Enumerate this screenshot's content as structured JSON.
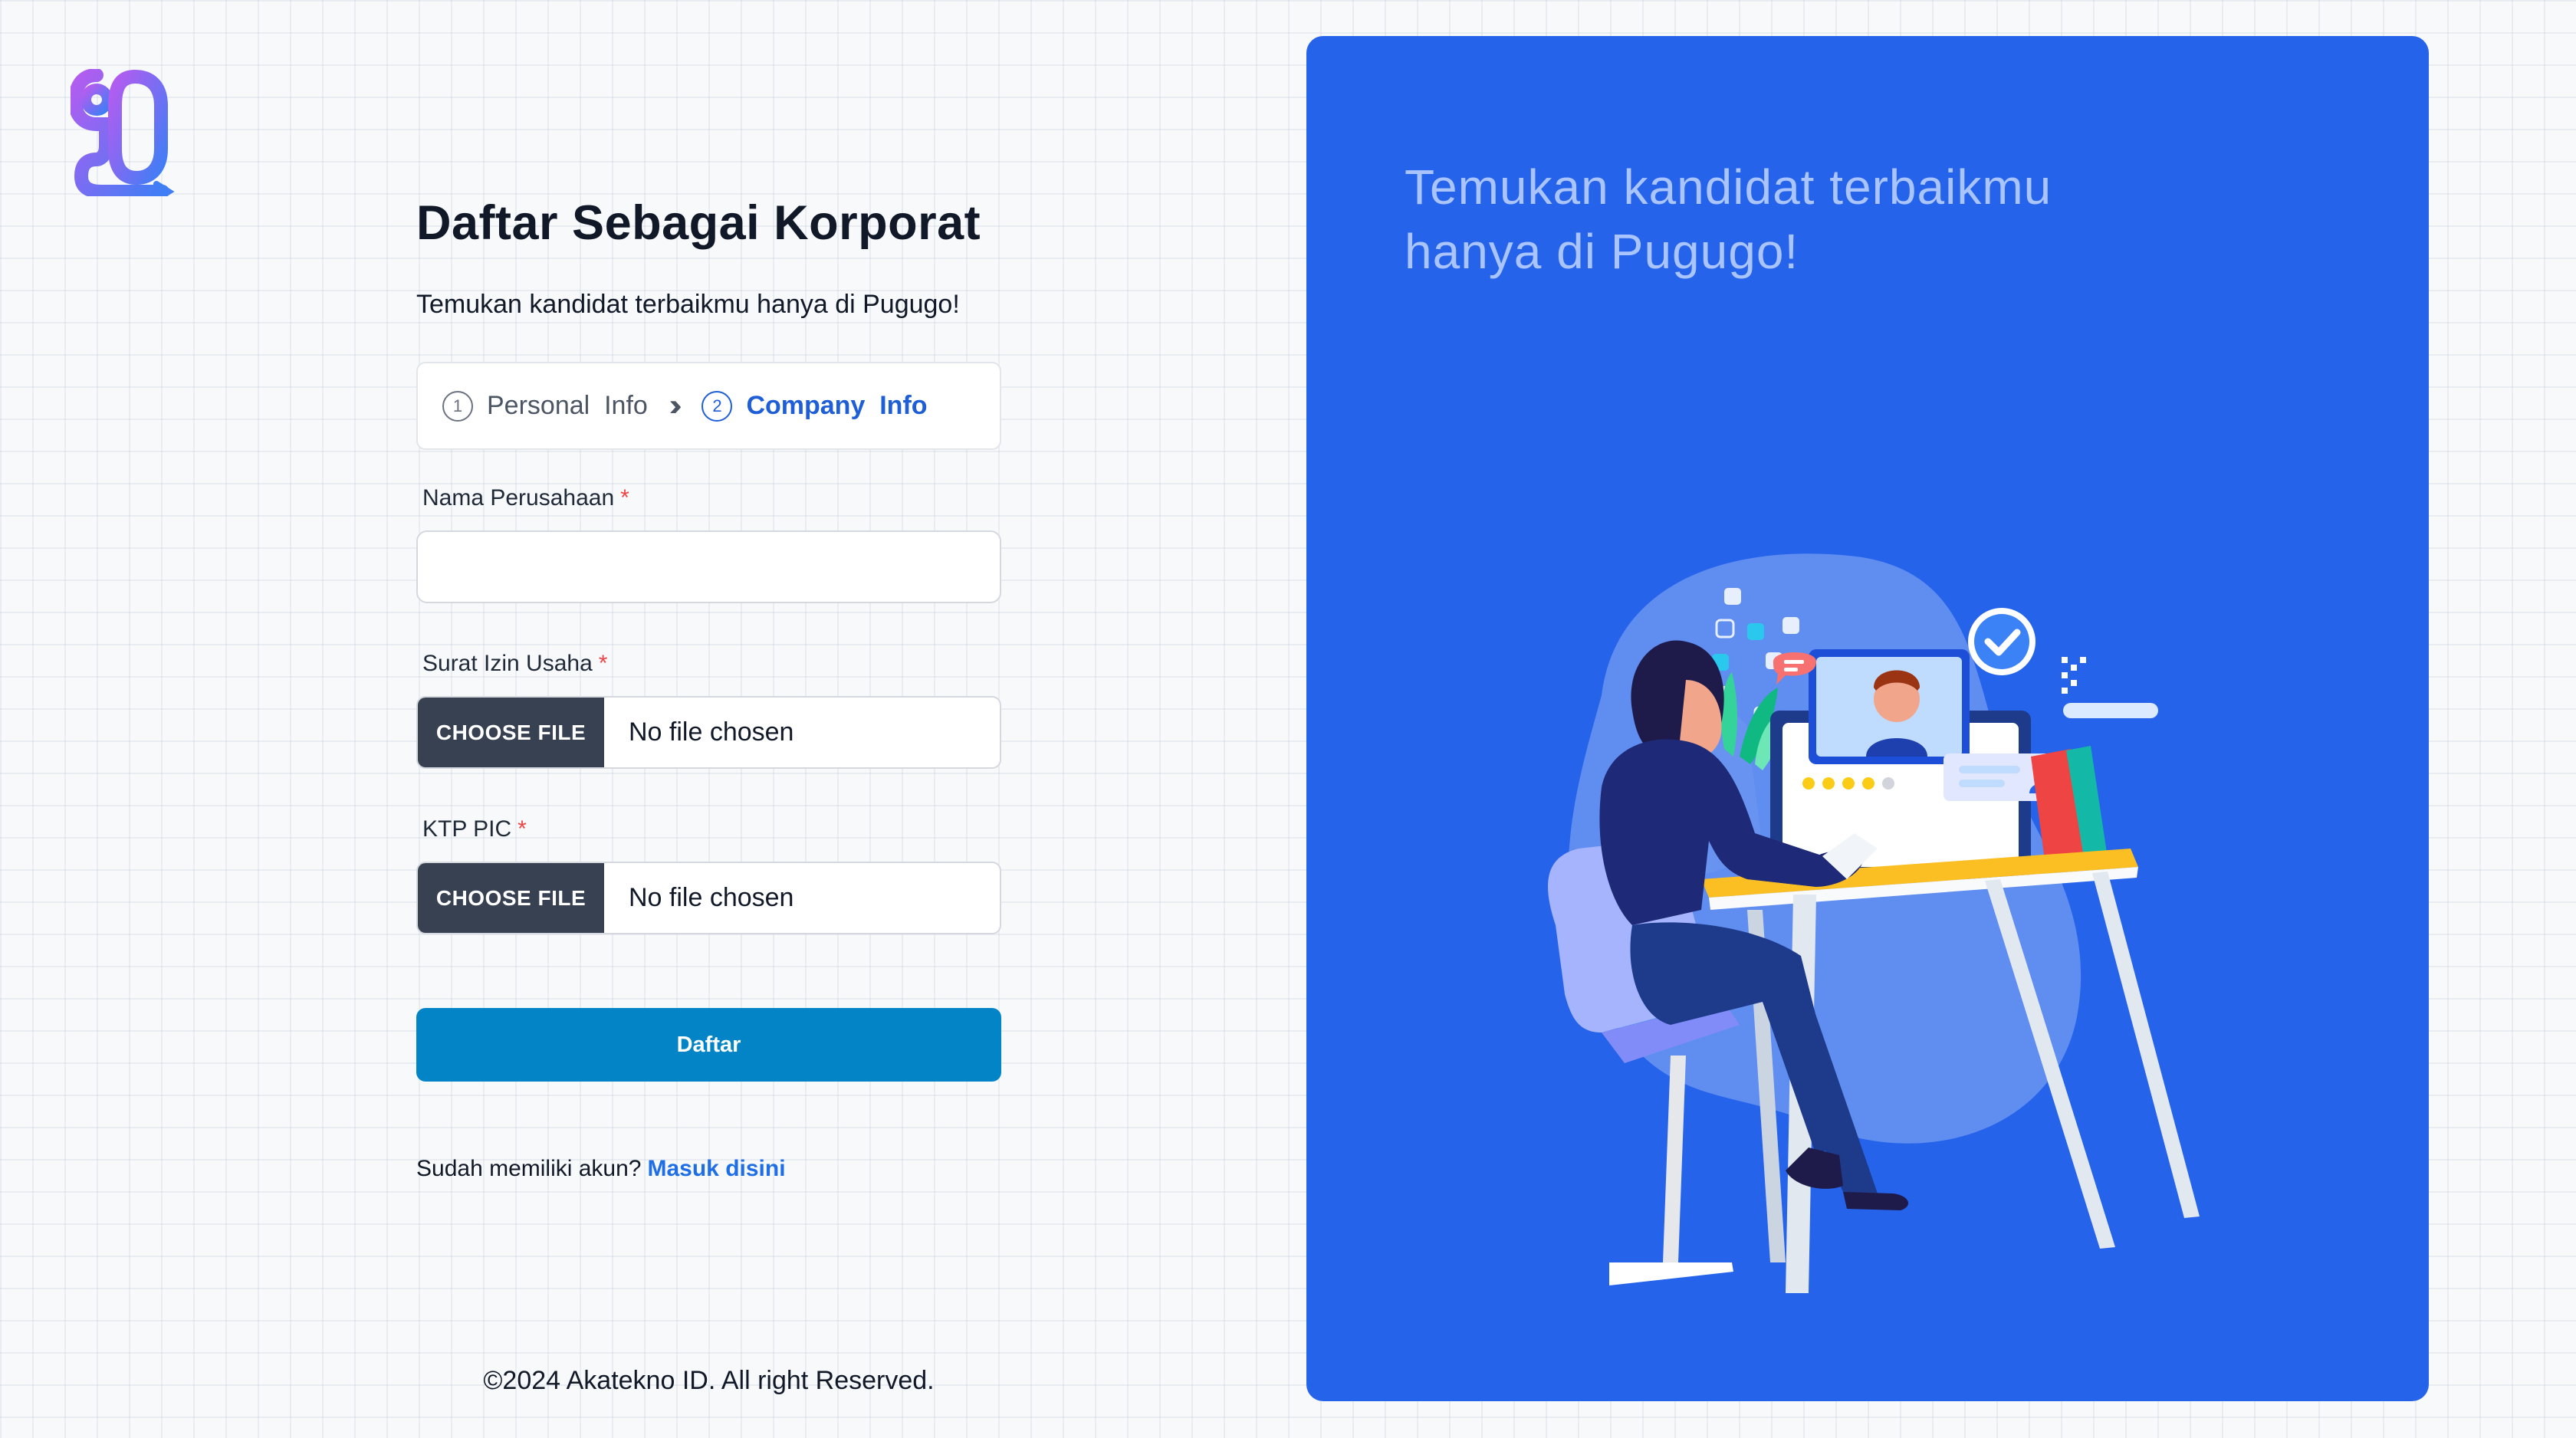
{
  "brand": {
    "logo_icon": "pugugo-logo-icon",
    "colors": {
      "gradient_start": "#a855f7",
      "gradient_end": "#3b82f6"
    }
  },
  "form": {
    "title": "Daftar Sebagai Korporat",
    "subtitle": "Temukan kandidat terbaikmu hanya di Pugugo!",
    "stepper": {
      "steps": [
        {
          "number": "1",
          "label": "Personal  Info",
          "state": "inactive"
        },
        {
          "number": "2",
          "label": "Company  Info",
          "state": "active"
        }
      ],
      "separator_icon": "double-chevron-right-icon"
    },
    "fields": {
      "company_name": {
        "label": "Nama Perusahaan",
        "required_mark": "*",
        "value": ""
      },
      "business_permit": {
        "label": "Surat Izin Usaha",
        "required_mark": "*",
        "button_label": "CHOOSE FILE",
        "status": "No file chosen"
      },
      "ktp_pic": {
        "label": "KTP PIC",
        "required_mark": "*",
        "button_label": "CHOOSE FILE",
        "status": "No file chosen"
      }
    },
    "submit_label": "Daftar",
    "login_prompt": "Sudah memiliki akun?",
    "login_link": "Masuk disini"
  },
  "footer": {
    "copyright": "©2024 Akatekno ID. All right Reserved."
  },
  "promo": {
    "heading": "Temukan kandidat terbaikmu hanya di Pugugo!",
    "illustration": "recruiter-video-interview-illustration",
    "background_color": "#2563eb"
  },
  "colors": {
    "primary_button": "#0284c7",
    "active_step": "#1e5fd8",
    "link": "#1e6ee8",
    "required": "#ef4444",
    "file_button": "#374151"
  }
}
